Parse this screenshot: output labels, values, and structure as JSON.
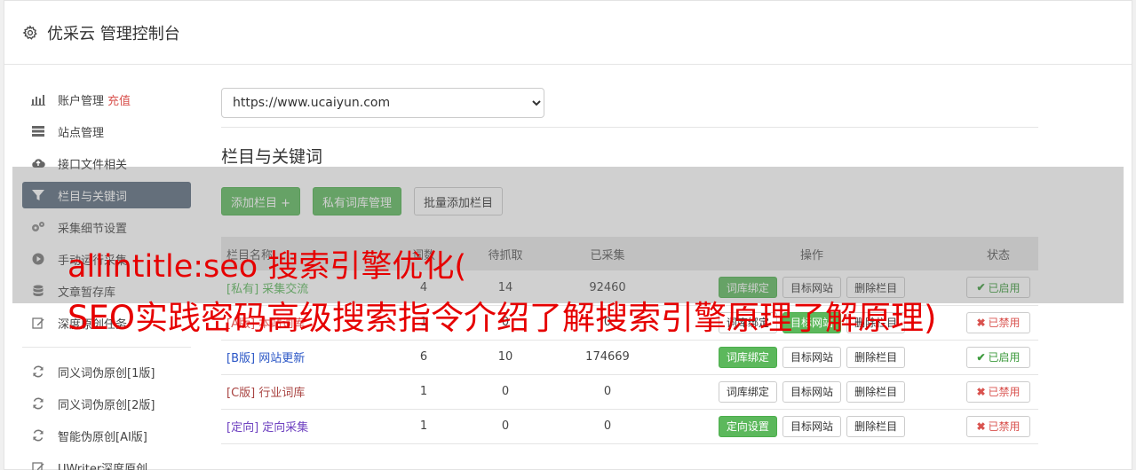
{
  "header": {
    "title": "优采云 管理控制台",
    "icon": "gear-icon"
  },
  "sidebar": {
    "items": [
      {
        "label": "账户管理",
        "extra": "充值",
        "icon": "bar-chart-icon"
      },
      {
        "label": "站点管理",
        "icon": "server-icon"
      },
      {
        "label": "接口文件相关",
        "icon": "cloud-upload-icon"
      },
      {
        "label": "栏目与关键词",
        "icon": "filter-icon",
        "active": true
      },
      {
        "label": "采集细节设置",
        "icon": "cogs-icon"
      },
      {
        "label": "手动运行采集",
        "icon": "play-circle-icon"
      },
      {
        "label": "文章暂存库",
        "icon": "database-icon"
      },
      {
        "label": "深度原创任务",
        "icon": "edit-icon"
      }
    ],
    "items2": [
      {
        "label": "同义词伪原创[1版]",
        "icon": "refresh-icon"
      },
      {
        "label": "同义词伪原创[2版]",
        "icon": "refresh-icon"
      },
      {
        "label": "智能伪原创[AI版]",
        "icon": "refresh-icon"
      },
      {
        "label": "UWriter深度原创",
        "icon": "edit-icon"
      }
    ]
  },
  "main": {
    "site_url": "https://www.ucaiyun.com",
    "section_title": "栏目与关键词",
    "buttons": {
      "add_column": "添加栏目 +",
      "private_lib": "私有词库管理",
      "batch_add": "批量添加栏目"
    },
    "table": {
      "headers": [
        "栏目名称",
        "词数",
        "待抓取",
        "已采集",
        "操作",
        "状态"
      ],
      "rows": [
        {
          "tag": "[私有]",
          "name": "采集交流",
          "words": "4",
          "pending": "14",
          "collected": "92460",
          "op1": "词库绑定",
          "op1_green": true,
          "op2": "目标网站",
          "op3": "删除栏目",
          "status": "已启用",
          "on": true
        },
        {
          "tag": "[A版]",
          "name": "本站词库",
          "words": "1",
          "pending": "0",
          "collected": "0",
          "op1": "词库绑定",
          "op1_green": false,
          "op2": "目标网站",
          "op3": "删除栏目",
          "status": "已禁用",
          "on": false
        },
        {
          "tag": "[B版]",
          "name": "网站更新",
          "words": "6",
          "pending": "10",
          "collected": "174669",
          "op1": "词库绑定",
          "op1_green": true,
          "op2": "目标网站",
          "op3": "删除栏目",
          "status": "已启用",
          "on": true
        },
        {
          "tag": "[C版]",
          "name": "行业词库",
          "words": "1",
          "pending": "0",
          "collected": "0",
          "op1": "词库绑定",
          "op1_green": false,
          "op2": "目标网站",
          "op3": "删除栏目",
          "status": "已禁用",
          "on": false
        },
        {
          "tag": "[定向]",
          "name": "定向采集",
          "words": "1",
          "pending": "0",
          "collected": "0",
          "op1": "定向设置",
          "op1_green": true,
          "op2": "目标网站",
          "op3": "删除栏目",
          "status": "已禁用",
          "on": false
        }
      ]
    }
  },
  "overlay": {
    "line1": "allintitle:seo 搜索引擎优化(",
    "line2": "SEO实践密码高级搜索指令介绍了解搜索引擎原理了解原理)"
  },
  "colors": {
    "green": "#5cb85c",
    "active_nav": "#5a6b7d",
    "red": "#d9534f",
    "overlay_text": "#e60000"
  }
}
